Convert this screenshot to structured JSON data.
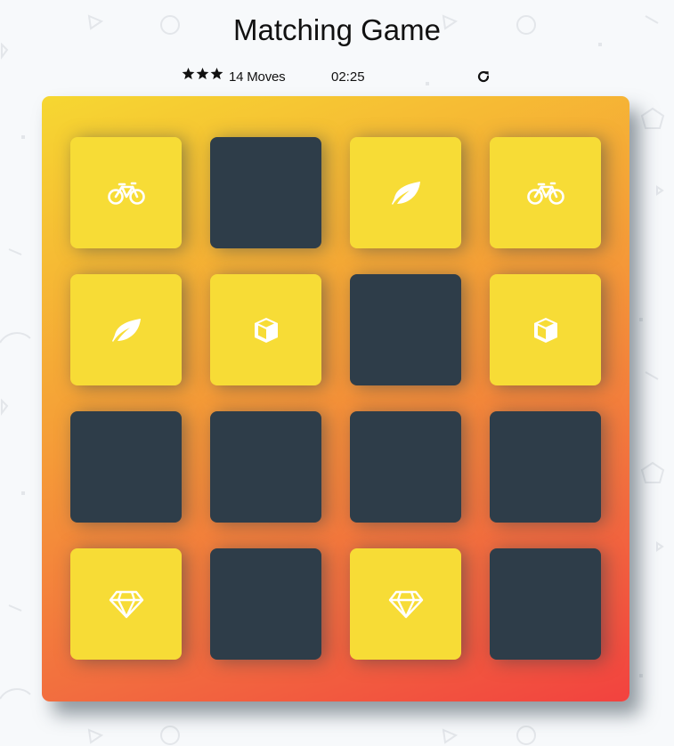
{
  "title": "Matching Game",
  "score_panel": {
    "star_icons": [
      "star-icon",
      "star-icon",
      "star-icon"
    ],
    "moves_text": "14 Moves",
    "timer_text": "02:25",
    "restart_icon": "refresh-icon"
  },
  "colors": {
    "background": "#f7f9fb",
    "card_closed": "#2e3d49",
    "card_matched": "#f7dc36",
    "deck_gradient": [
      "#f6d731",
      "#f59a38",
      "#f26c3f",
      "#f2423f"
    ]
  },
  "deck": {
    "columns": 4,
    "rows": 4,
    "cards": [
      {
        "state": "match",
        "icon": "bicycle-icon"
      },
      {
        "state": "closed",
        "icon": ""
      },
      {
        "state": "match",
        "icon": "leaf-icon"
      },
      {
        "state": "match",
        "icon": "bicycle-icon"
      },
      {
        "state": "match",
        "icon": "leaf-icon"
      },
      {
        "state": "match",
        "icon": "cube-icon"
      },
      {
        "state": "closed",
        "icon": ""
      },
      {
        "state": "match",
        "icon": "cube-icon"
      },
      {
        "state": "closed",
        "icon": ""
      },
      {
        "state": "closed",
        "icon": ""
      },
      {
        "state": "closed",
        "icon": ""
      },
      {
        "state": "closed",
        "icon": ""
      },
      {
        "state": "match",
        "icon": "diamond-icon"
      },
      {
        "state": "closed",
        "icon": ""
      },
      {
        "state": "match",
        "icon": "diamond-icon"
      },
      {
        "state": "closed",
        "icon": ""
      }
    ]
  }
}
